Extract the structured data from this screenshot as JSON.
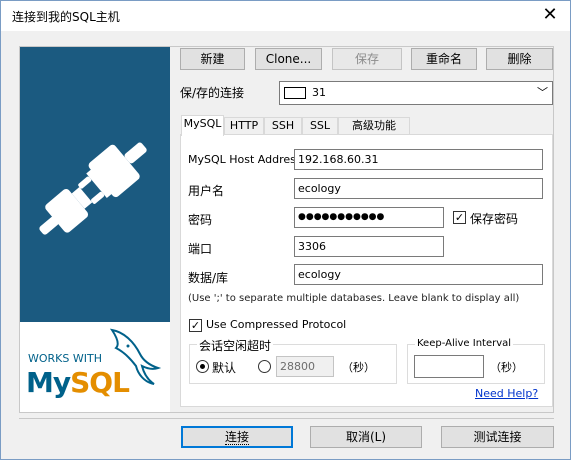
{
  "window": {
    "title": "连接到我的SQL主机",
    "close_glyph": "✕"
  },
  "toolbar": {
    "new_label": "新建",
    "clone_label": "Clone...",
    "save_label": "保存",
    "rename_label": "重命名",
    "delete_label": "删除"
  },
  "saved_connection": {
    "label": "保/存的连接",
    "value": "31"
  },
  "tabs": [
    {
      "label": "MySQL",
      "active": true
    },
    {
      "label": "HTTP",
      "active": false
    },
    {
      "label": "SSH",
      "active": false
    },
    {
      "label": "SSL",
      "active": false
    },
    {
      "label": "高级功能",
      "active": false
    }
  ],
  "form": {
    "host_label": "MySQL Host Address",
    "host_value": "192.168.60.31",
    "user_label": "用户名",
    "user_value": "ecology",
    "password_label": "密码",
    "password_value": "●●●●●●●●●●●",
    "save_password_label": "保存密码",
    "save_password_checked": true,
    "port_label": "端口",
    "port_value": "3306",
    "database_label": "数据/库",
    "database_value": "ecology",
    "database_hint": "(Use ';' to separate multiple databases. Leave blank to display all)",
    "compressed_label": "Use Compressed Protocol",
    "compressed_checked": true
  },
  "session_timeout": {
    "title": "会话空闲超时",
    "default_label": "默认",
    "custom_value": "28800",
    "unit": "（秒）"
  },
  "keep_alive": {
    "title": "Keep-Alive Interval",
    "value": "",
    "unit": "（秒）"
  },
  "help_link": "Need Help?",
  "footer": {
    "connect_label": "连接",
    "cancel_label": "取消(L)",
    "test_label": "测试连接"
  },
  "logo": {
    "works_with": "WORKS WITH",
    "brand": "MySQL"
  },
  "colors": {
    "sidebar_blue": "#1b5a80",
    "mysql_blue": "#00618a",
    "mysql_orange": "#e48e00",
    "link_blue": "#0033cc"
  }
}
